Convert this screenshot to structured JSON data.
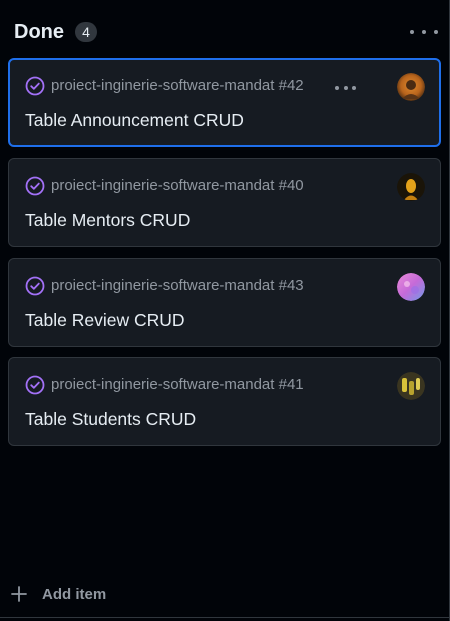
{
  "column": {
    "title": "Done",
    "count": "4"
  },
  "cards": [
    {
      "repo": "proiect-inginerie-software-mandat #42",
      "title": "Table Announcement CRUD",
      "selected": true,
      "avatar_colors": [
        "#b8641c",
        "#3d2410"
      ]
    },
    {
      "repo": "proiect-inginerie-software-mandat #40",
      "title": "Table Mentors CRUD",
      "selected": false,
      "avatar_colors": [
        "#e3a21a",
        "#1a1408"
      ]
    },
    {
      "repo": "proiect-inginerie-software-mandat #43",
      "title": "Table Review CRUD",
      "selected": false,
      "avatar_colors": [
        "#d86bd8",
        "#6f9be8"
      ]
    },
    {
      "repo": "proiect-inginerie-software-mandat #41",
      "title": "Table Students CRUD",
      "selected": false,
      "avatar_colors": [
        "#d9c23a",
        "#3a3520"
      ]
    }
  ],
  "footer": {
    "add_item_label": "Add item"
  },
  "colors": {
    "background": "#010409",
    "card_background": "#161b22",
    "card_border": "#30363d",
    "selected_border": "#1f6feb",
    "done_purple": "#a371f7",
    "muted_text": "#9198a1",
    "primary_text": "#e6edf3"
  },
  "icons": {
    "status": "issue-closed-check-icon",
    "column_menu": "kebab-horizontal-icon",
    "card_menu": "kebab-horizontal-icon",
    "add": "plus-icon"
  }
}
